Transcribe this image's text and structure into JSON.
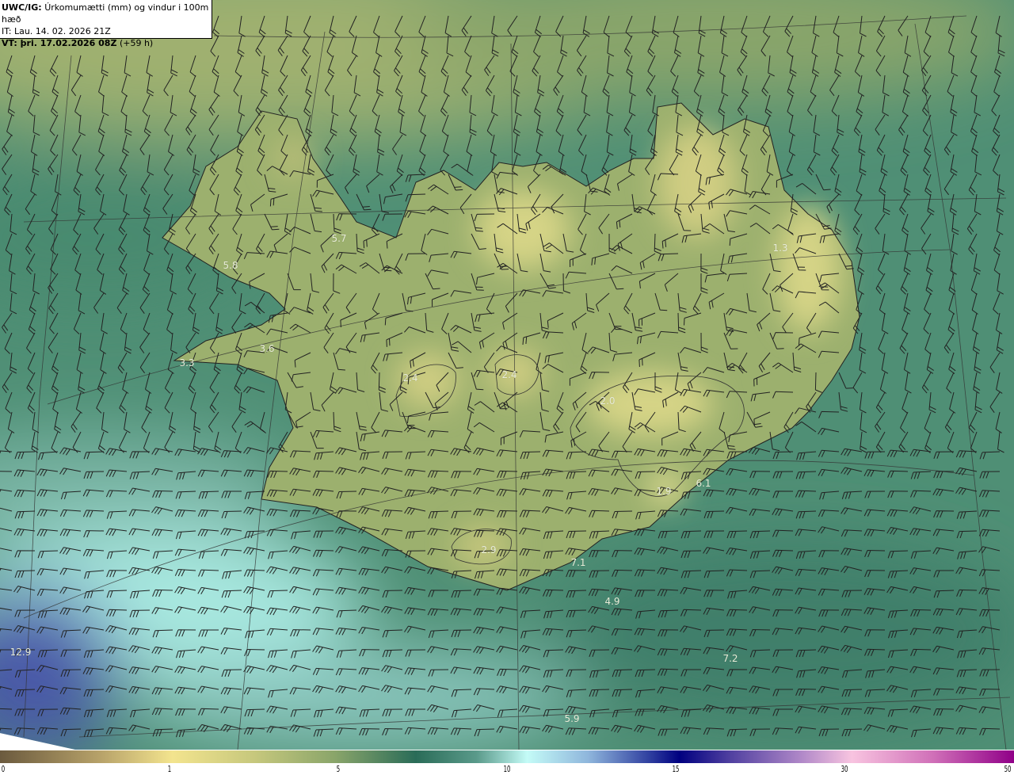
{
  "header": {
    "model": "UWC/IG:",
    "title": "Úrkomumætti (mm) og vindur i 100m hæð",
    "init_time": "IT: Lau. 14. 02. 2026 21Z",
    "valid_label": "VT: þri. 17.02.2026 08Z",
    "lead": "(+59 h)"
  },
  "colors": {
    "ocean": "#4f8f75",
    "land_low": "#8aa56a",
    "land_high": "#d2cf85",
    "coastline": "#222222"
  },
  "colorbar": {
    "ticks": [
      "0",
      "1",
      "5",
      "10",
      "15",
      "30",
      "50"
    ],
    "stops": [
      "#6b5a3e",
      "#f3e48e",
      "#2a6c58",
      "#c4fbf7",
      "#000080",
      "#f8c4e0",
      "#900088"
    ]
  },
  "map_labels": [
    "5.7",
    "5.8",
    "3.6",
    "3.3",
    "2.4",
    "2.4",
    "2.0",
    "1.3",
    "6.1",
    "1.9",
    "2.9",
    "7.1",
    "4.9",
    "7.2",
    "5.9",
    "12.9"
  ],
  "wind_barbs_icon": "wind-barb-icon"
}
